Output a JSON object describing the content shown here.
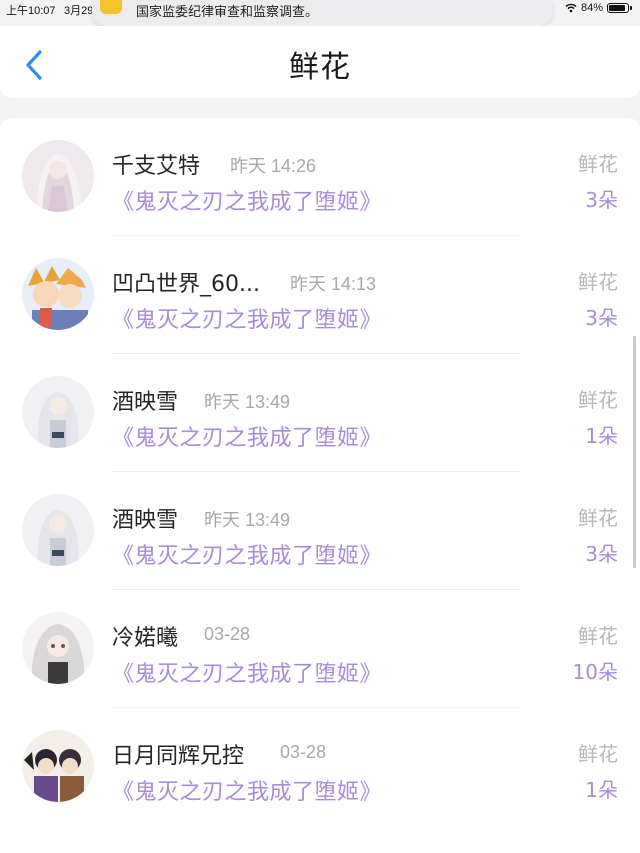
{
  "status_bar": {
    "time": "上午10:07",
    "date": "3月29",
    "battery": "84%"
  },
  "notification": {
    "text": "国家监委纪律审查和监察调查。"
  },
  "header": {
    "title": "鲜花"
  },
  "list": [
    {
      "name": "千支艾特",
      "time": "昨天 14:26",
      "book": "《鬼灭之刃之我成了堕姬》",
      "type": "鲜花",
      "count": "3朵"
    },
    {
      "name": "凹凸世界_60...",
      "time": "昨天 14:13",
      "book": "《鬼灭之刃之我成了堕姬》",
      "type": "鲜花",
      "count": "3朵"
    },
    {
      "name": "酒映雪",
      "time": "昨天 13:49",
      "book": "《鬼灭之刃之我成了堕姬》",
      "type": "鲜花",
      "count": "1朵"
    },
    {
      "name": "酒映雪",
      "time": "昨天 13:49",
      "book": "《鬼灭之刃之我成了堕姬》",
      "type": "鲜花",
      "count": "3朵"
    },
    {
      "name": "冷婼曦",
      "time": "03-28",
      "book": "《鬼灭之刃之我成了堕姬》",
      "type": "鲜花",
      "count": "10朵"
    },
    {
      "name": "日月同辉兄控",
      "time": "03-28",
      "book": "《鬼灭之刃之我成了堕姬》",
      "type": "鲜花",
      "count": "1朵"
    }
  ],
  "colors": {
    "accent": "#a98bd6",
    "back_arrow": "#2f8cf2"
  }
}
